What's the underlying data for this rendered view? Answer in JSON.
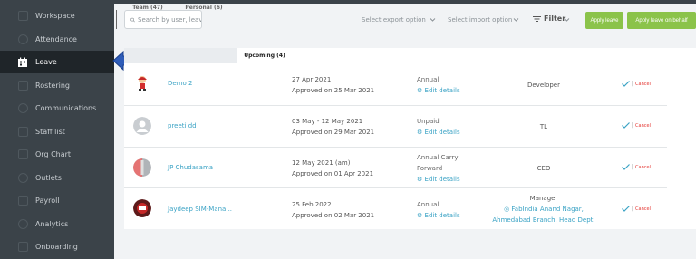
{
  "colors": {
    "sidebar": "#3b4349",
    "sidebar_active": "#1f2529",
    "accent_green": "#8bc34a",
    "link_blue": "#3ba3c5",
    "cancel_red": "#e53935",
    "pointer_blue": "#2e5cb8"
  },
  "sidebar": {
    "items": [
      {
        "label": "Workspace",
        "icon": "workspace-icon"
      },
      {
        "label": "Attendance",
        "icon": "attendance-icon"
      },
      {
        "label": "Leave",
        "icon": "leave-icon",
        "active": true
      },
      {
        "label": "Rostering",
        "icon": "rostering-icon"
      },
      {
        "label": "Communications",
        "icon": "communications-icon"
      },
      {
        "label": "Staff list",
        "icon": "staff-list-icon"
      },
      {
        "label": "Org Chart",
        "icon": "org-chart-icon"
      },
      {
        "label": "Outlets",
        "icon": "outlets-icon"
      },
      {
        "label": "Payroll",
        "icon": "payroll-icon"
      },
      {
        "label": "Analytics",
        "icon": "analytics-icon"
      },
      {
        "label": "Onboarding",
        "icon": "onboarding-icon"
      }
    ]
  },
  "toolbar": {
    "search_placeholder": "Search by user, leav",
    "export_label": "Select export option",
    "import_label": "Select import option",
    "filter_label": "Filter",
    "apply_leave": "Apply leave",
    "apply_leave_behalf": "Apply leave on behalf"
  },
  "tabs": [
    {
      "label": "Team (47)"
    },
    {
      "label": "Personal (6)"
    },
    {
      "label": "Upcoming (4)",
      "active": true
    }
  ],
  "rows": [
    {
      "name": "Demo 2",
      "dates": "27 Apr 2021",
      "approved": "Approved on 25 Mar 2021",
      "type_lines": [
        "Annual"
      ],
      "edit": "Edit details",
      "role_lines": [
        "Developer"
      ],
      "location": "",
      "cancel": "Cancel"
    },
    {
      "name": "preeti dd",
      "dates": "03 May - 12 May 2021",
      "approved": "Approved on 29 Mar 2021",
      "type_lines": [
        "Unpaid"
      ],
      "edit": "Edit details",
      "role_lines": [
        "TL"
      ],
      "location": "",
      "cancel": "Cancel"
    },
    {
      "name": "JP Chudasama",
      "dates": "12 May 2021 (am)",
      "approved": "Approved on 01 Apr 2021",
      "type_lines": [
        "Annual Carry",
        "Forward"
      ],
      "edit": "Edit details",
      "role_lines": [
        "CEO"
      ],
      "location": "",
      "cancel": "Cancel"
    },
    {
      "name": "Jaydeep SIM-Mana...",
      "dates": "25 Feb 2022",
      "approved": "Approved on 02 Mar 2021",
      "type_lines": [
        "Annual"
      ],
      "edit": "Edit details",
      "role_lines": [
        "Manager"
      ],
      "location": [
        "FabIndia Anand Nagar,",
        "Ahmedabad Branch, Head Dept."
      ],
      "cancel": "Cancel"
    }
  ]
}
